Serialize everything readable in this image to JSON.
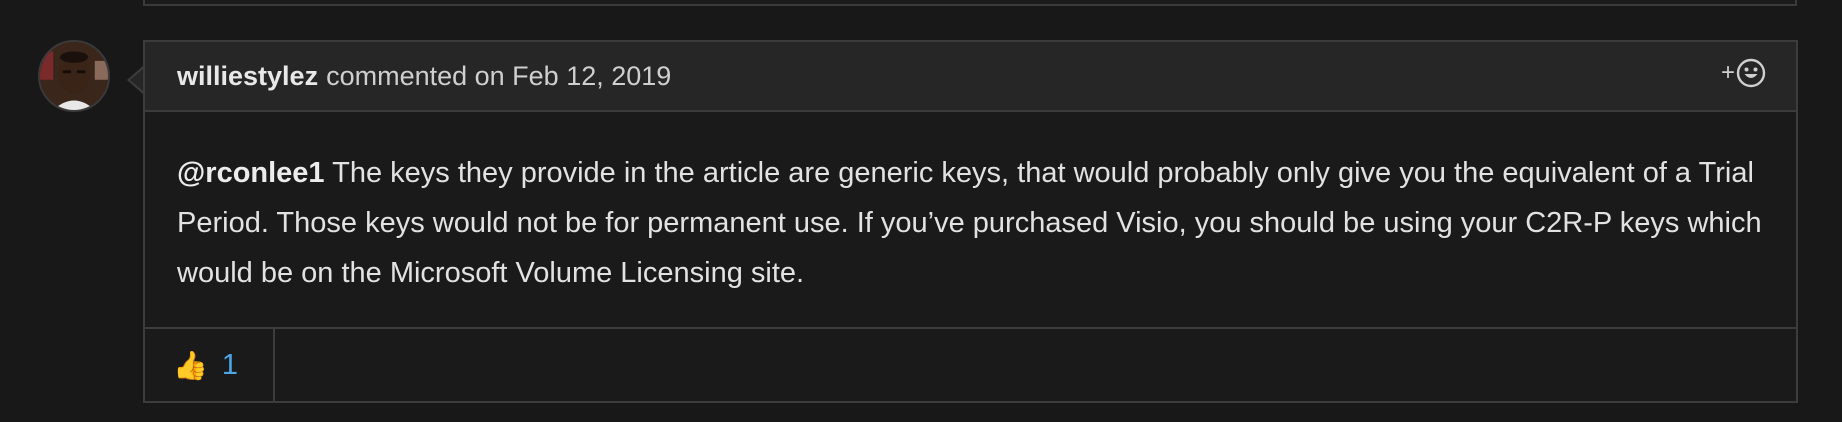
{
  "comment": {
    "author": "williestylez",
    "action": "commented on Feb 12, 2019",
    "body": {
      "mention": "@rconlee1",
      "text": " The keys they provide in the article are generic keys, that would probably only give you the equivalent of a Trial Period. Those keys would not be for permanent use. If you’ve purchased Visio, you should be using your C2R-P keys which would be on the Microsoft Volume Licensing site."
    },
    "add_reaction": {
      "plus": "+",
      "icon": "smiley-icon"
    },
    "reactions": [
      {
        "emoji": "👍",
        "icon": "thumbs-up-icon",
        "count": "1"
      }
    ]
  },
  "colors": {
    "background": "#181818",
    "card_header": "#262626",
    "border": "#3c3c3c",
    "reaction_count": "#4ea6e8"
  }
}
